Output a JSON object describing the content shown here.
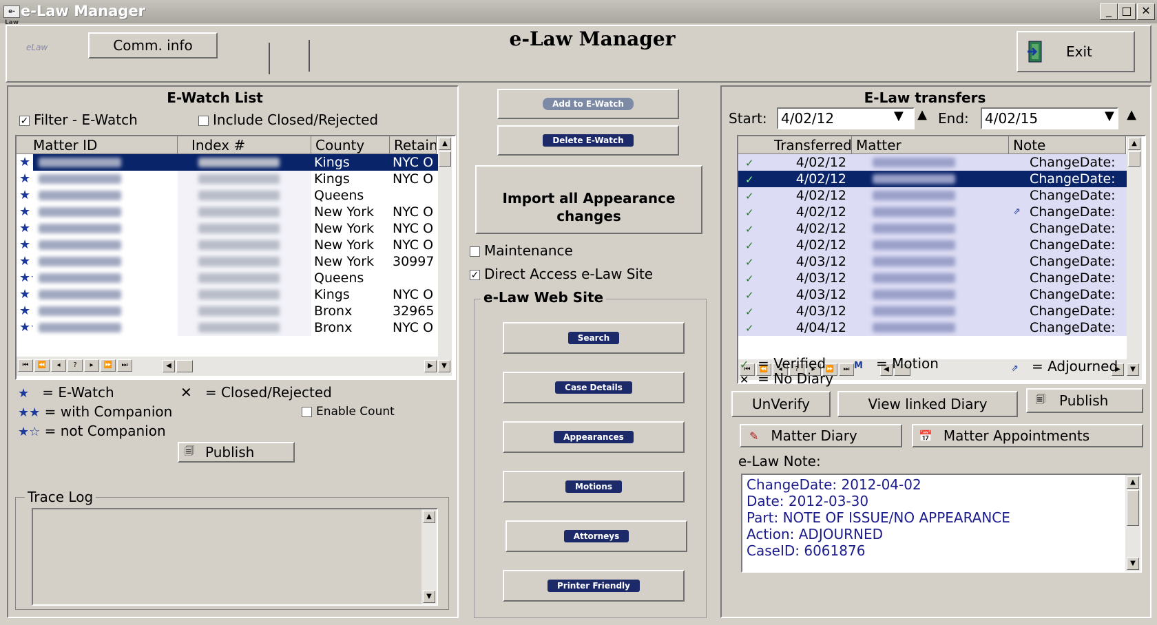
{
  "window": {
    "title": "e-Law Manager",
    "icon_label": "e-Law",
    "min": "_",
    "max": "□",
    "close": "✕"
  },
  "header": {
    "title": "e-Law Manager",
    "comm_info": "Comm. info",
    "logo_text": "eLaw",
    "exit": "Exit"
  },
  "ewatch": {
    "title": "E-Watch List",
    "filter_label": "Filter - E-Watch",
    "filter_checked": true,
    "include_closed_label": "Include Closed/Rejected",
    "include_closed_checked": false,
    "columns": [
      "Matter ID",
      "Index #",
      "County",
      "Retain"
    ],
    "rows": [
      {
        "mark": "★",
        "county": "Kings",
        "retain": "NYC O",
        "selected": true
      },
      {
        "mark": "★",
        "county": "Kings",
        "retain": "NYC O"
      },
      {
        "mark": "★",
        "county": "Queens",
        "retain": ""
      },
      {
        "mark": "★",
        "county": "New York",
        "retain": "NYC O"
      },
      {
        "mark": "★",
        "county": "New York",
        "retain": "NYC O"
      },
      {
        "mark": "★",
        "county": "New York",
        "retain": "NYC O"
      },
      {
        "mark": "★",
        "county": "New York",
        "retain": "30997"
      },
      {
        "mark": "★☆",
        "county": "Queens",
        "retain": ""
      },
      {
        "mark": "★",
        "county": "Kings",
        "retain": "NYC O"
      },
      {
        "mark": "★",
        "county": "Bronx",
        "retain": "32965"
      },
      {
        "mark": "★☆",
        "county": "Bronx",
        "retain": "NYC O"
      }
    ],
    "legend": {
      "ewatch": "= E-Watch",
      "with_companion": "= with Companion",
      "not_companion": "= not Companion",
      "closed": "= Closed/Rejected",
      "enable_count": "Enable Count"
    },
    "publish": "Publish",
    "trace_log": "Trace Log"
  },
  "middle": {
    "add_ewatch": "Add to E-Watch",
    "delete_ewatch": "Delete E-Watch",
    "import_all": "Import all Appearance changes",
    "maintenance": "Maintenance",
    "maintenance_checked": false,
    "direct_access": "Direct Access e-Law Site",
    "direct_access_checked": true,
    "web_site_title": "e-Law Web Site",
    "buttons": [
      "Search",
      "Case Details",
      "Appearances",
      "Motions",
      "Attorneys",
      "Printer Friendly"
    ]
  },
  "transfers": {
    "title": "E-Law transfers",
    "start_label": "Start:",
    "start_value": "4/02/12",
    "end_label": "End:",
    "end_value": "4/02/15",
    "columns": [
      "Transferred",
      "Matter",
      "Note"
    ],
    "rows": [
      {
        "mark": "✓",
        "date": "4/02/12",
        "note": "ChangeDate:"
      },
      {
        "mark": "✓",
        "date": "4/02/12",
        "note": "ChangeDate:",
        "selected": true
      },
      {
        "mark": "✓",
        "date": "4/02/12",
        "note": "ChangeDate:"
      },
      {
        "mark": "✓",
        "date": "4/02/12",
        "note": "ChangeDate:",
        "adjourned": true
      },
      {
        "mark": "✓",
        "date": "4/02/12",
        "note": "ChangeDate:"
      },
      {
        "mark": "✓",
        "date": "4/02/12",
        "note": "ChangeDate:"
      },
      {
        "mark": "✓",
        "date": "4/03/12",
        "note": "ChangeDate:"
      },
      {
        "mark": "✓",
        "date": "4/03/12",
        "note": "ChangeDate:"
      },
      {
        "mark": "✓",
        "date": "4/03/12",
        "note": "ChangeDate:"
      },
      {
        "mark": "✓",
        "date": "4/03/12",
        "note": "ChangeDate:"
      },
      {
        "mark": "✓",
        "date": "4/04/12",
        "note": "ChangeDate:"
      }
    ],
    "legend": {
      "verified": "= Verified",
      "motion": "= Motion",
      "adjourned": "= Adjourned",
      "no_diary": "= No Diary"
    },
    "unverify": "UnVerify",
    "view_linked_diary": "View linked Diary",
    "publish": "Publish",
    "matter_diary": "Matter Diary",
    "matter_appointments": "Matter Appointments",
    "note_label": "e-Law Note:",
    "note_lines": [
      "ChangeDate: 2012-04-02",
      "Date: 2012-03-30",
      "Part: NOTE OF ISSUE/NO APPEARANCE",
      "Action: ADJOURNED",
      "CaseID: 6061876"
    ]
  },
  "colors": {
    "selection": "#0a246a",
    "grid_tint": "#dcdcf4",
    "note_text": "#1a1a8a",
    "pill": "#1c2a6a"
  }
}
